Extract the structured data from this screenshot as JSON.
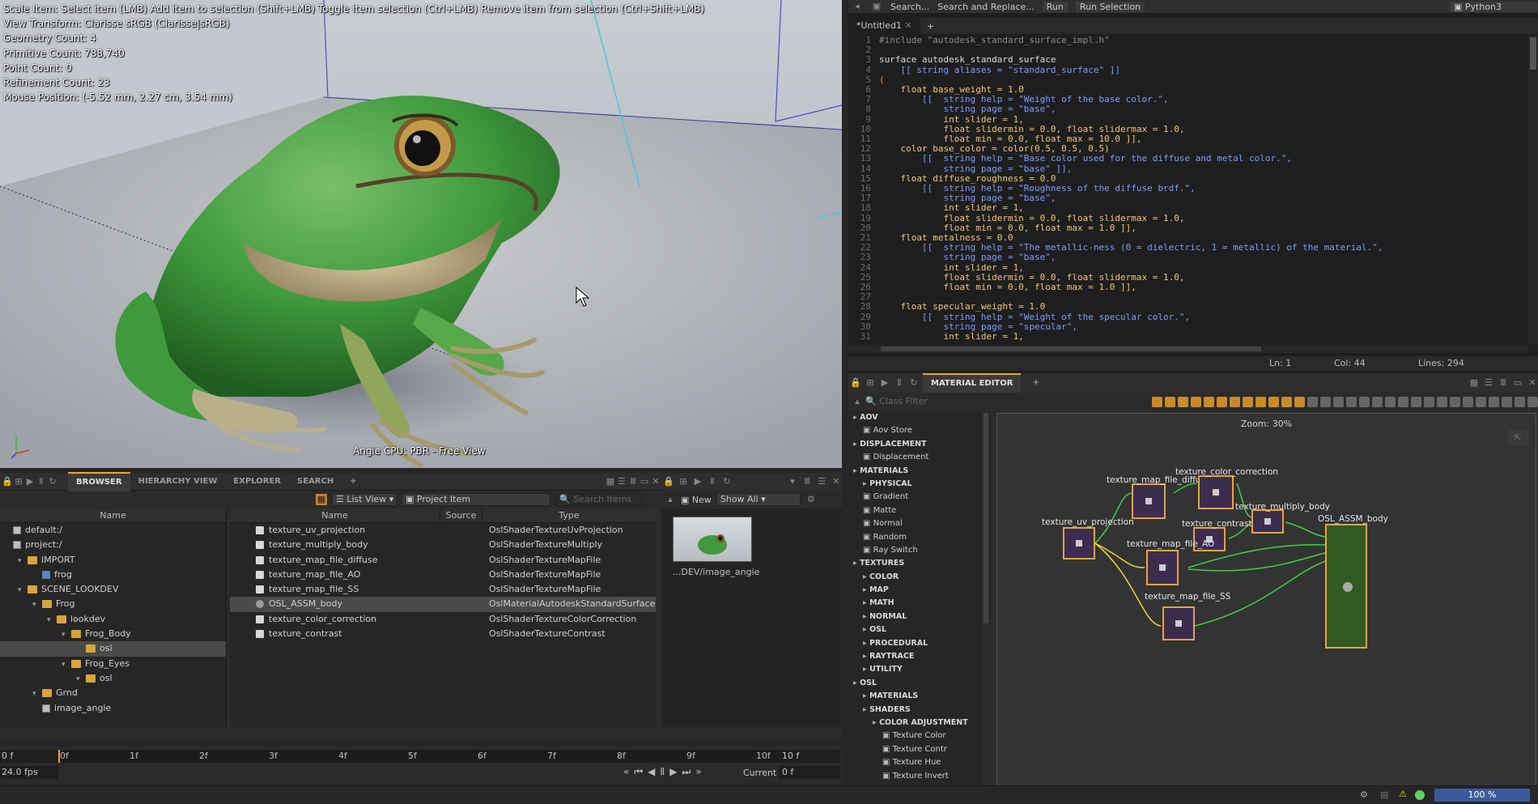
{
  "viewport": {
    "info_lines": [
      "Scale Item: Select item (LMB)  Add item to selection (Shift+LMB)  Toggle item selection (Ctrl+LMB)  Remove item from selection (Ctrl+Shift+LMB)",
      "View Transform: Clarisse sRGB (Clarisse|sRGB)",
      "Geometry Count: 4",
      "Primitive Count: 788,740",
      "Point Count: 0",
      "Refinement Count: 23",
      "Mouse Position: (-5.52 mm, 2.27 cm, 3.54 mm)"
    ],
    "caption": "Angie CPU: PBR - Free View"
  },
  "browser": {
    "tabs": [
      "BROWSER",
      "HIERARCHY VIEW",
      "EXPLORER",
      "SEARCH",
      "+"
    ],
    "active_tab": "BROWSER",
    "view_mode": "List View",
    "filter": "Project Item",
    "search_placeholder": "Search Items",
    "tree_header": "Name",
    "tree": [
      {
        "label": "default:/",
        "depth": 0,
        "icon": "context"
      },
      {
        "label": "project:/",
        "depth": 0,
        "icon": "context"
      },
      {
        "label": "IMPORT",
        "depth": 1,
        "icon": "folder"
      },
      {
        "label": "frog",
        "depth": 2,
        "icon": "context-blue"
      },
      {
        "label": "SCENE_LOOKDEV",
        "depth": 1,
        "icon": "folder"
      },
      {
        "label": "Frog",
        "depth": 2,
        "icon": "folder"
      },
      {
        "label": "lookdev",
        "depth": 3,
        "icon": "folder"
      },
      {
        "label": "Frog_Body",
        "depth": 4,
        "icon": "folder"
      },
      {
        "label": "osl",
        "depth": 5,
        "icon": "folder",
        "selected": true
      },
      {
        "label": "Frog_Eyes",
        "depth": 4,
        "icon": "folder"
      },
      {
        "label": "osl",
        "depth": 5,
        "icon": "folder"
      },
      {
        "label": "Grnd",
        "depth": 2,
        "icon": "folder"
      },
      {
        "label": "image_angie",
        "depth": 2,
        "icon": "image"
      }
    ],
    "columns": [
      "Name",
      "Source",
      "Type"
    ],
    "items": [
      {
        "name": "texture_uv_projection",
        "source": "",
        "type": "OslShaderTextureUvProjection"
      },
      {
        "name": "texture_multiply_body",
        "source": "",
        "type": "OslShaderTextureMultiply"
      },
      {
        "name": "texture_map_file_diffuse",
        "source": "",
        "type": "OslShaderTextureMapFile"
      },
      {
        "name": "texture_map_file_AO",
        "source": "",
        "type": "OslShaderTextureMapFile"
      },
      {
        "name": "texture_map_file_SS",
        "source": "",
        "type": "OslShaderTextureMapFile"
      },
      {
        "name": "OSL_ASSM_body",
        "source": "",
        "type": "OslMaterialAutodeskStandardSurface",
        "selected": true
      },
      {
        "name": "texture_color_correction",
        "source": "",
        "type": "OslShaderTextureColorCorrection"
      },
      {
        "name": "texture_contrast",
        "source": "",
        "type": "OslShaderTextureContrast"
      }
    ]
  },
  "image_panel": {
    "new_label": "New",
    "show_label": "Show All",
    "thumb_caption": "...DEV/image_angie"
  },
  "code_editor": {
    "toolbar": [
      "Search...",
      "Search and Replace...",
      "Run",
      "Run Selection"
    ],
    "language": "Python3",
    "tab": "*Untitled1",
    "lines": [
      "#include \"autodesk_standard_surface_impl.h\"",
      "",
      "surface autodesk_standard_surface",
      "    [[ string aliases = \"standard_surface\" ]]",
      "(",
      "    float base_weight = 1.0",
      "        [[  string help = \"Weight of the base color.\",",
      "            string page = \"base\",",
      "            int slider = 1,",
      "            float slidermin = 0.0, float slidermax = 1.0,",
      "            float min = 0.0, float max = 10.0 ]],",
      "    color base_color = color(0.5, 0.5, 0.5)",
      "        [[  string help = \"Base color used for the diffuse and metal color.\",",
      "            string page = \"base\" ]],",
      "    float diffuse_roughness = 0.0",
      "        [[  string help = \"Roughness of the diffuse brdf.\",",
      "            string page = \"base\",",
      "            int slider = 1,",
      "            float slidermin = 0.0, float slidermax = 1.0,",
      "            float min = 0.0, float max = 1.0 ]],",
      "    float metalness = 0.0",
      "        [[  string help = \"The metallic-ness (0 = dielectric, 1 = metallic) of the material.\",",
      "            string page = \"base\",",
      "            int slider = 1,",
      "            float slidermin = 0.0, float slidermax = 1.0,",
      "            float min = 0.0, float max = 1.0 ]],",
      "",
      "    float specular_weight = 1.0",
      "        [[  string help = \"Weight of the specular color.\",",
      "            string page = \"specular\",",
      "            int slider = 1,"
    ],
    "status": {
      "ln": "Ln: 1",
      "col": "Col: 44",
      "lines": "Lines: 294"
    }
  },
  "material_editor": {
    "tab": "MATERIAL EDITOR",
    "filter_placeholder": "Class Filter",
    "zoom": "Zoom: 30%",
    "list": [
      {
        "label": "AOV",
        "type": "cat",
        "depth": 0
      },
      {
        "label": "Aov Store",
        "type": "item",
        "depth": 1
      },
      {
        "label": "DISPLACEMENT",
        "type": "cat",
        "depth": 0
      },
      {
        "label": "Displacement",
        "type": "item",
        "depth": 1
      },
      {
        "label": "MATERIALS",
        "type": "cat",
        "depth": 0
      },
      {
        "label": "PHYSICAL",
        "type": "cat",
        "depth": 1
      },
      {
        "label": "Gradient",
        "type": "item",
        "depth": 1
      },
      {
        "label": "Matte",
        "type": "item",
        "depth": 1
      },
      {
        "label": "Normal",
        "type": "item",
        "depth": 1
      },
      {
        "label": "Random",
        "type": "item",
        "depth": 1
      },
      {
        "label": "Ray Switch",
        "type": "item",
        "depth": 1
      },
      {
        "label": "TEXTURES",
        "type": "cat",
        "depth": 0
      },
      {
        "label": "COLOR",
        "type": "cat",
        "depth": 1
      },
      {
        "label": "MAP",
        "type": "cat",
        "depth": 1
      },
      {
        "label": "MATH",
        "type": "cat",
        "depth": 1
      },
      {
        "label": "NORMAL",
        "type": "cat",
        "depth": 1
      },
      {
        "label": "OSL",
        "type": "cat",
        "depth": 1
      },
      {
        "label": "PROCEDURAL",
        "type": "cat",
        "depth": 1
      },
      {
        "label": "RAYTRACE",
        "type": "cat",
        "depth": 1
      },
      {
        "label": "UTILITY",
        "type": "cat",
        "depth": 1
      },
      {
        "label": "OSL",
        "type": "cat",
        "depth": 0
      },
      {
        "label": "MATERIALS",
        "type": "cat",
        "depth": 1
      },
      {
        "label": "SHADERS",
        "type": "cat",
        "depth": 1
      },
      {
        "label": "COLOR ADJUSTMENT",
        "type": "cat",
        "depth": 2
      },
      {
        "label": "Texture Color",
        "type": "item",
        "depth": 3
      },
      {
        "label": "Texture Contr",
        "type": "item",
        "depth": 3
      },
      {
        "label": "Texture Hue",
        "type": "item",
        "depth": 3
      },
      {
        "label": "Texture Invert",
        "type": "item",
        "depth": 3
      }
    ],
    "nodes": {
      "uv": "texture_uv_projection",
      "diffuse": "texture_map_file_diffuse",
      "cc": "texture_color_correction",
      "mult": "texture_multiply_body",
      "contrast": "texture_contrast",
      "ao": "texture_map_file_AO",
      "ss": "texture_map_file_SS",
      "assm": "OSL_ASSM_body"
    }
  },
  "timeline": {
    "ticks": [
      "0f",
      "1f",
      "2f",
      "3f",
      "4f",
      "5f",
      "6f",
      "7f",
      "8f",
      "9f",
      "10f"
    ],
    "start": "0 f",
    "end": "10 f",
    "fps": "24.0 fps",
    "current_label": "Current",
    "current_value": "0 f"
  },
  "statusbar": {
    "zoom": "100 %"
  }
}
